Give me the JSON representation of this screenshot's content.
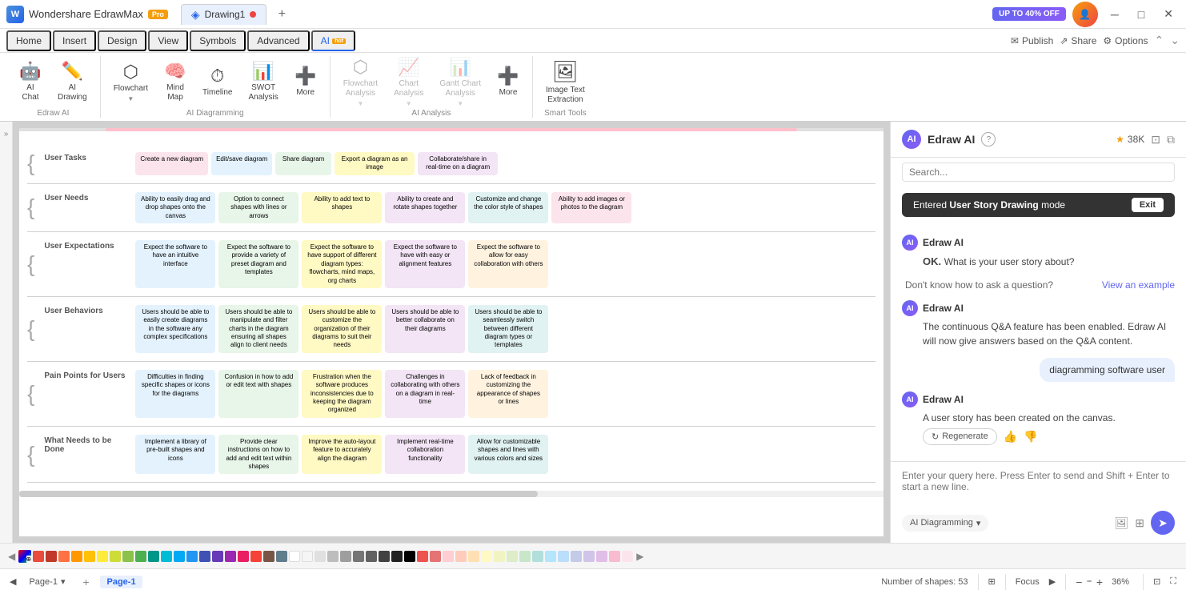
{
  "titleBar": {
    "appName": "Wondershare EdrawMax",
    "proBadge": "Pro",
    "tabName": "Drawing1",
    "discountBadge": "UP TO 40% OFF"
  },
  "menuBar": {
    "items": [
      "Home",
      "Insert",
      "Design",
      "View",
      "Symbols",
      "Advanced",
      "AI"
    ],
    "activeItem": "AI",
    "hotBadge": "hot",
    "rightItems": {
      "publish": "Publish",
      "share": "Share",
      "options": "Options"
    }
  },
  "ribbon": {
    "sections": [
      {
        "label": "Edraw AI",
        "items": [
          {
            "icon": "🤖",
            "label": "AI\nChat",
            "id": "ai-chat"
          },
          {
            "icon": "✏️",
            "label": "AI\nDrawing",
            "id": "ai-drawing"
          }
        ]
      },
      {
        "label": "AI Diagramming",
        "items": [
          {
            "icon": "⬡",
            "label": "Flowchart",
            "id": "flowchart",
            "hasDropdown": true
          },
          {
            "icon": "🧠",
            "label": "Mind\nMap",
            "id": "mind-map"
          },
          {
            "icon": "⏱",
            "label": "Timeline",
            "id": "timeline"
          },
          {
            "icon": "📊",
            "label": "SWOT\nAnalysis",
            "id": "swot"
          },
          {
            "icon": "➕",
            "label": "More",
            "id": "more1"
          }
        ]
      },
      {
        "label": "AI Analysis",
        "items": [
          {
            "icon": "⬡",
            "label": "Flowchart\nAnalysis",
            "id": "flowchart-analysis",
            "hasDropdown": true,
            "disabled": true
          },
          {
            "icon": "📈",
            "label": "Chart\nAnalysis",
            "id": "chart-analysis",
            "hasDropdown": true,
            "disabled": true
          },
          {
            "icon": "📊",
            "label": "Gantt Chart\nAnalysis",
            "id": "gantt-analysis",
            "hasDropdown": true,
            "disabled": true
          },
          {
            "icon": "➕",
            "label": "More",
            "id": "more2"
          }
        ]
      },
      {
        "label": "Smart Tools",
        "items": [
          {
            "icon": "🖼",
            "label": "Image Text\nExtraction",
            "id": "image-extraction"
          }
        ]
      }
    ]
  },
  "diagram": {
    "rows": [
      {
        "label": "User Tasks",
        "cards": [
          {
            "text": "Create a new diagram",
            "color": "pink"
          },
          {
            "text": "Edit/save diagram",
            "color": "blue"
          },
          {
            "text": "Share diagram",
            "color": "green"
          },
          {
            "text": "Export a diagram as an image",
            "color": "yellow"
          },
          {
            "text": "Collaborate/share in real-time on a diagram",
            "color": "purple"
          }
        ]
      },
      {
        "label": "User Needs",
        "cards": [
          {
            "text": "Ability to easily drag and drop shapes onto the canvas",
            "color": "blue"
          },
          {
            "text": "Option to connect shapes with lines or arrows",
            "color": "green"
          },
          {
            "text": "Ability to add text to shapes",
            "color": "yellow"
          },
          {
            "text": "Ability to create and rotate shapes together",
            "color": "purple"
          },
          {
            "text": "Customize and change the color style of shapes",
            "color": "teal"
          },
          {
            "text": "Ability to add images or photos to the diagram",
            "color": "pink"
          }
        ]
      },
      {
        "label": "User Expectations",
        "cards": [
          {
            "text": "Expect the software to have an intuitive interface",
            "color": "blue"
          },
          {
            "text": "Expect the software to provide a variety of preset diagram and templates",
            "color": "green"
          },
          {
            "text": "Expect the software to have support of different diagram types: flowcharts, mind maps, org charts",
            "color": "yellow"
          },
          {
            "text": "Expect the software to have with easy or alignment features",
            "color": "purple"
          },
          {
            "text": "Expect the software to allow for easy collaboration with others",
            "color": "orange"
          }
        ]
      },
      {
        "label": "User Behaviors",
        "cards": [
          {
            "text": "Users should be able to easily create diagrams in the software any complex specifications",
            "color": "blue"
          },
          {
            "text": "Users should be able to manipulate and filter charts in the diagram ensuring all shapes align to client needs",
            "color": "green"
          },
          {
            "text": "Users should be able to customize the organization of their diagrams to suit their needs",
            "color": "yellow"
          },
          {
            "text": "Users should be able to better collaborate on their diagrams",
            "color": "purple"
          },
          {
            "text": "Users should be able to seamlessly switch between different diagram types or templates",
            "color": "teal"
          }
        ]
      },
      {
        "label": "Pain Points for Users",
        "cards": [
          {
            "text": "Difficulties in finding specific shapes or icons for the diagrams",
            "color": "blue"
          },
          {
            "text": "Confusion in how to add or edit text with shapes",
            "color": "green"
          },
          {
            "text": "Frustration when the software produces inconsistencies due to keeping the diagram organized",
            "color": "yellow"
          },
          {
            "text": "Challenges in collaborating with others on a diagram in real-time",
            "color": "purple"
          },
          {
            "text": "Lack of feedback in customizing the appearance of shapes or lines",
            "color": "orange"
          }
        ]
      },
      {
        "label": "What Needs to be Done",
        "cards": [
          {
            "text": "Implement a library of pre-built shapes and icons",
            "color": "blue"
          },
          {
            "text": "Provide clear instructions on how to add and edit text within shapes",
            "color": "green"
          },
          {
            "text": "Improve the auto-layout feature to accurately align the diagram",
            "color": "yellow"
          },
          {
            "text": "Implement real-time collaboration functionality",
            "color": "purple"
          },
          {
            "text": "Allow for customizable shapes and lines with various colors and sizes",
            "color": "teal"
          }
        ]
      }
    ]
  },
  "aiPanel": {
    "title": "Edraw AI",
    "points": "38K",
    "modeBanner": {
      "label": "Entered",
      "mode": "User Story Drawing",
      "modeText": "mode",
      "exitLabel": "Exit"
    },
    "messages": [
      {
        "type": "ai",
        "name": "Edraw AI",
        "text": "OK. What is your user story about?",
        "subtext": ""
      },
      {
        "type": "ai-helper",
        "text": "Don't know how to ask a question?",
        "linkText": "View an example"
      },
      {
        "type": "ai",
        "name": "Edraw AI",
        "text": "The continuous Q&A feature has been enabled. Edraw AI will now give answers based on the Q&A content."
      },
      {
        "type": "user",
        "text": "diagramming software user"
      },
      {
        "type": "ai",
        "name": "Edraw AI",
        "text": "A user story has been created on the canvas.",
        "hasRegen": true,
        "regenLabel": "Regenerate"
      }
    ],
    "input": {
      "placeholder": "Enter your query here. Press Enter to send and Shift + Enter to start a new line."
    },
    "footer": {
      "modeLabel": "AI Diagramming"
    }
  },
  "colorBar": {
    "colors": [
      "#e74c3c",
      "#c0392b",
      "#ff6b6b",
      "#ff8c69",
      "#ff7043",
      "#ff5722",
      "#ff9800",
      "#ffc107",
      "#ffeb3b",
      "#cddc39",
      "#8bc34a",
      "#4caf50",
      "#009688",
      "#00bcd4",
      "#03a9f4",
      "#2196f3",
      "#3f51b5",
      "#673ab7",
      "#9c27b0",
      "#e91e63",
      "#ffffff",
      "#f5f5f5",
      "#e0e0e0",
      "#bdbdbd",
      "#9e9e9e",
      "#757575",
      "#616161",
      "#424242",
      "#212121",
      "#000000",
      "#795548",
      "#607d8b",
      "#f44336",
      "#e53935",
      "#ef5350",
      "#e57373",
      "#ffcdd2",
      "#ffccbc",
      "#ffe0b2",
      "#fff9c4",
      "#f0f4c3",
      "#dcedc8",
      "#c8e6c9",
      "#b2dfdb",
      "#b3e5fc",
      "#bbdefb",
      "#c5cae9",
      "#d1c4e9",
      "#e1bee7",
      "#f8bbd0",
      "#fce4ec",
      "#333333",
      "#555555",
      "#777777",
      "#999999"
    ]
  },
  "statusBar": {
    "pages": [
      {
        "label": "Page-1",
        "active": false
      },
      {
        "label": "Page-1",
        "active": true
      }
    ],
    "shapeCount": "Number of shapes: 53",
    "focus": "Focus",
    "zoom": "36%"
  }
}
